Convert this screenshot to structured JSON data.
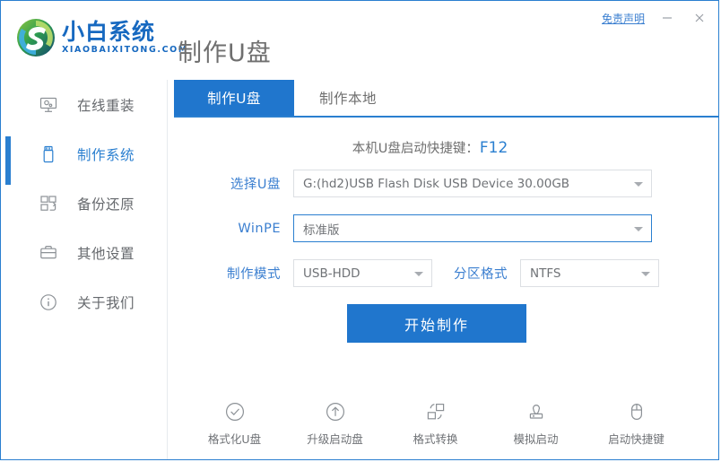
{
  "window": {
    "disclaimer_label": "免责声明",
    "minimize_label": "–",
    "close_label": "×",
    "accent_color": "#2076cd",
    "border_color": "#2a7fd0"
  },
  "brand": {
    "name_cn": "小白系统",
    "name_en": "XIAOBAIXITONG.COM"
  },
  "header": {
    "title": "制作U盘"
  },
  "sidebar": {
    "items": [
      {
        "label": "在线重装",
        "icon": "monitor-icon",
        "active": false
      },
      {
        "label": "制作系统",
        "icon": "usb-drive-icon",
        "active": true
      },
      {
        "label": "备份还原",
        "icon": "grid-squares-icon",
        "active": false
      },
      {
        "label": "其他设置",
        "icon": "briefcase-icon",
        "active": false
      },
      {
        "label": "关于我们",
        "icon": "info-circle-icon",
        "active": false
      }
    ]
  },
  "main": {
    "tabs": [
      {
        "label": "制作U盘",
        "active": true
      },
      {
        "label": "制作本地",
        "active": false
      }
    ],
    "hotkey": {
      "text": "本机U盘启动快捷键：",
      "value": "F12"
    },
    "fields": {
      "usb": {
        "label": "选择U盘",
        "value": "G:(hd2)USB Flash Disk USB Device 30.00GB",
        "focused": false
      },
      "winpe": {
        "label": "WinPE",
        "value": "标准版",
        "focused": true
      },
      "mode": {
        "label": "制作模式",
        "value": "USB-HDD",
        "focused": false
      },
      "partition": {
        "label": "分区格式",
        "value": "NTFS",
        "focused": false
      }
    },
    "start_button": "开始制作",
    "tools": [
      {
        "label": "格式化U盘",
        "icon": "check-circle-icon"
      },
      {
        "label": "升级启动盘",
        "icon": "arrow-up-circle-icon"
      },
      {
        "label": "格式转换",
        "icon": "convert-icon"
      },
      {
        "label": "模拟启动",
        "icon": "joystick-icon"
      },
      {
        "label": "启动快捷键",
        "icon": "mouse-icon"
      }
    ]
  }
}
